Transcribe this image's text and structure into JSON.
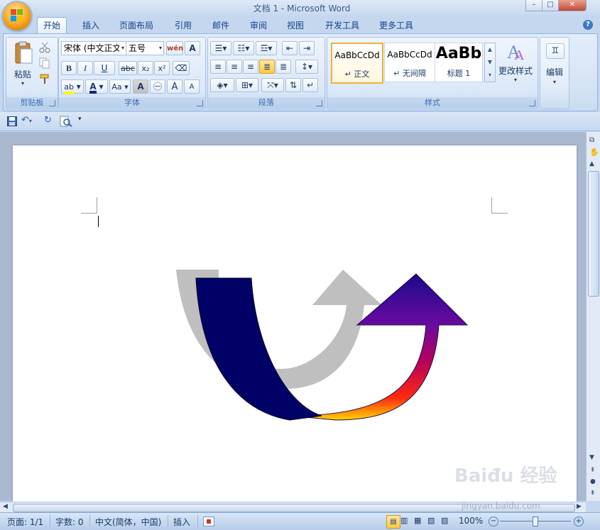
{
  "window": {
    "title": "文档 1 - Microsoft Word",
    "controls": {
      "minimize": "–",
      "maximize": "□",
      "close": "✕"
    }
  },
  "tabs": [
    "开始",
    "插入",
    "页面布局",
    "引用",
    "邮件",
    "审阅",
    "视图",
    "开发工具",
    "更多工具"
  ],
  "active_tab": "开始",
  "help": "?",
  "ribbon": {
    "clipboard": {
      "label": "剪贴板",
      "paste": "粘贴"
    },
    "font": {
      "label": "字体",
      "font_name": "宋体 (中文正文)",
      "font_size": "五号",
      "bold": "B",
      "italic": "I",
      "underline": "U",
      "strikethrough": "abc",
      "subscript": "x₂",
      "superscript": "x²",
      "grow": "A",
      "shrink": "A",
      "case": "Aa"
    },
    "paragraph": {
      "label": "段落"
    },
    "styles": {
      "label": "样式",
      "cards": [
        {
          "sample": "AaBbCcDd",
          "name": "↵ 正文"
        },
        {
          "sample": "AaBbCcDd",
          "name": "↵ 无间隔"
        },
        {
          "sample": "AaBb",
          "name": "标题 1"
        }
      ],
      "change_styles": "更改样式"
    },
    "editing": {
      "label": "编辑"
    }
  },
  "status": {
    "page": "页面: 1/1",
    "words": "字数: 0",
    "language": "中文(简体，中国)",
    "mode": "插入",
    "zoom": "100%"
  },
  "watermark": {
    "text": "Baiđu 经验",
    "url": "jingyan.baidu.com"
  },
  "colors": {
    "accent": "#15428b",
    "arrow_dark": "#000066",
    "arrow_gradient_top": "#330099",
    "arrow_gradient_mid": "#990066",
    "arrow_gradient_bottom": "#ffcc00",
    "shadow": "#bfbfbf"
  }
}
